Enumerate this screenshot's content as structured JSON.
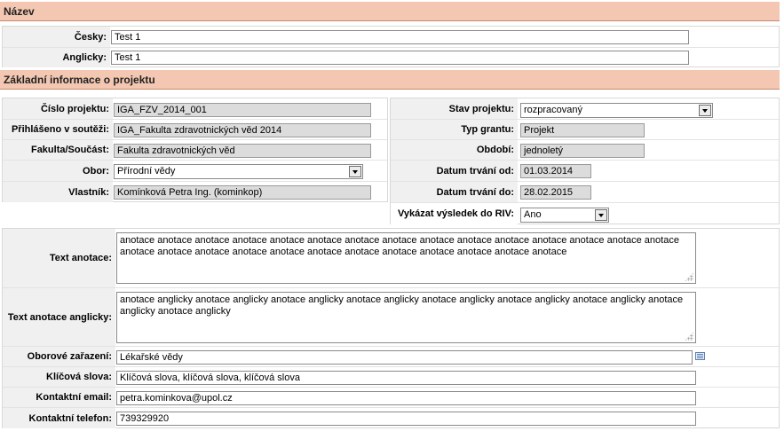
{
  "sections": {
    "name_title": "Název",
    "basic_info_title": "Základní informace o projektu"
  },
  "name": {
    "cz_label": "Česky:",
    "cz_value": "Test 1",
    "en_label": "Anglicky:",
    "en_value": "Test 1"
  },
  "left": {
    "project_number_label": "Číslo projektu:",
    "project_number_value": "IGA_FZV_2014_001",
    "competition_label": "Přihlášeno v soutěži:",
    "competition_value": "IGA_Fakulta zdravotnických věd 2014",
    "faculty_label": "Fakulta/Součást:",
    "faculty_value": "Fakulta zdravotnických věd",
    "field_label": "Obor:",
    "field_value": "Přírodní vědy",
    "owner_label": "Vlastník:",
    "owner_value": "Komínková Petra Ing.  (kominkop)"
  },
  "right": {
    "status_label": "Stav projektu:",
    "status_value": "rozpracovaný",
    "grant_type_label": "Typ grantu:",
    "grant_type_value": "Projekt",
    "period_label": "Období:",
    "period_value": "jednoletý",
    "date_from_label": "Datum trvání od:",
    "date_from_value": "01.03.2014",
    "date_to_label": "Datum trvání do:",
    "date_to_value": "28.02.2015",
    "riv_label": "Vykázat výsledek do RIV:",
    "riv_value": "Ano"
  },
  "details": {
    "annotation_label": "Text anotace:",
    "annotation_value": "anotace anotace anotace anotace anotace anotace anotace anotace anotace anotace anotace anotace anotace anotace anotace anotace anotace anotace anotace anotace anotace anotace anotace anotace anotace anotace anotace",
    "annotation_en_label": "Text anotace anglicky:",
    "annotation_en_value": "anotace anglicky anotace anglicky anotace anglicky anotace anglicky anotace anglicky anotace anglicky anotace anglicky anotace anglicky anotace anglicky",
    "classification_label": "Oborové zařazení:",
    "classification_value": "Lékařské vědy",
    "keywords_label": "Klíčová slova:",
    "keywords_value": "Klíčová slova, klíčová slova, klíčová slova",
    "email_label": "Kontaktní email:",
    "email_value": "petra.kominkova@upol.cz",
    "phone_label": "Kontaktní telefon:",
    "phone_value": "739329920"
  }
}
